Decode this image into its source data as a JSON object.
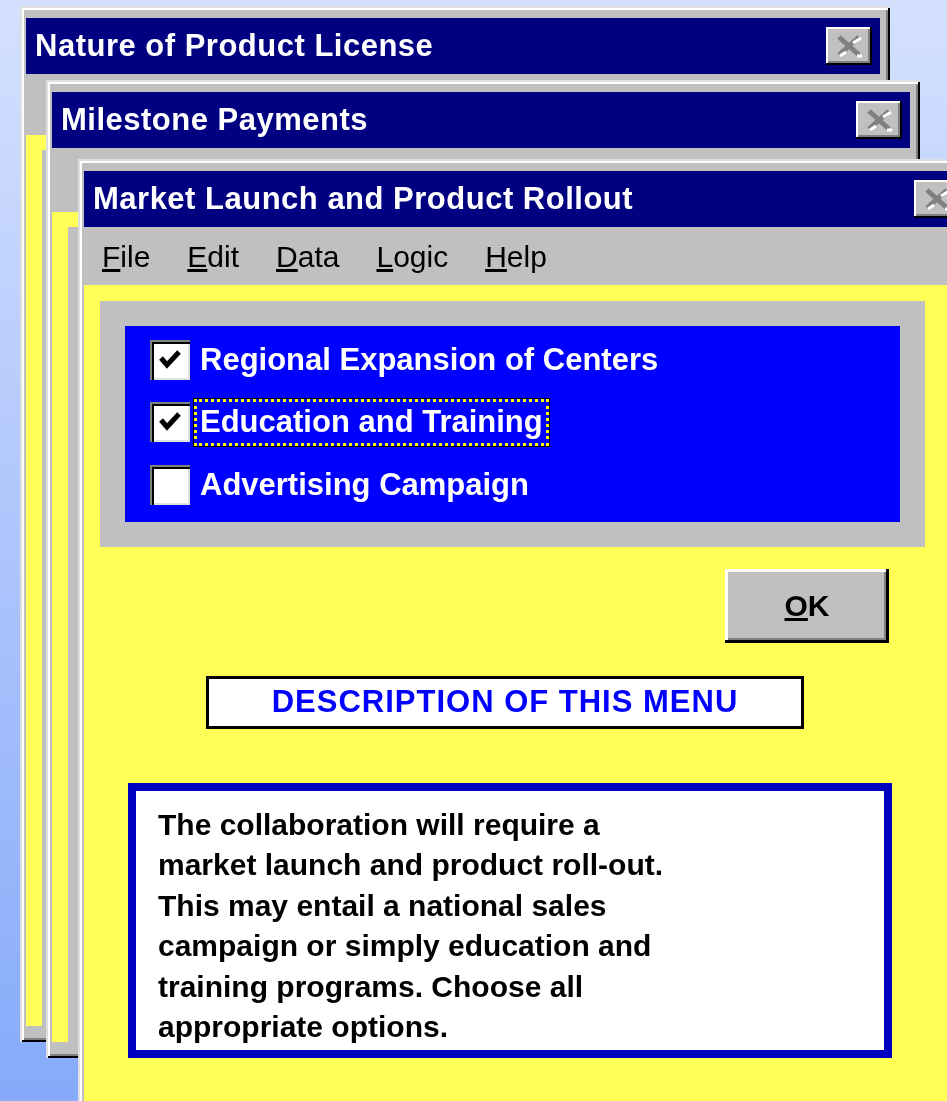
{
  "windows": [
    {
      "title": "Nature of Product License"
    },
    {
      "title": "Milestone Payments"
    },
    {
      "title": "Market Launch and Product Rollout",
      "menu": [
        {
          "label": "File"
        },
        {
          "label": "Edit"
        },
        {
          "label": "Data"
        },
        {
          "label": "Logic"
        },
        {
          "label": "Help"
        }
      ],
      "options": [
        {
          "label": "Regional Expansion of Centers",
          "checked": true,
          "focused": false
        },
        {
          "label": "Education and Training",
          "checked": true,
          "focused": true
        },
        {
          "label": "Advertising Campaign",
          "checked": false,
          "focused": false
        }
      ],
      "ok_button": "OK",
      "description_heading": "DESCRIPTION OF THIS MENU",
      "description": "The collaboration will require a\nmarket launch and product roll-out.\nThis may entail a national sales\ncampaign or simply education and\ntraining programs.  Choose all\nappropriate options."
    }
  ]
}
